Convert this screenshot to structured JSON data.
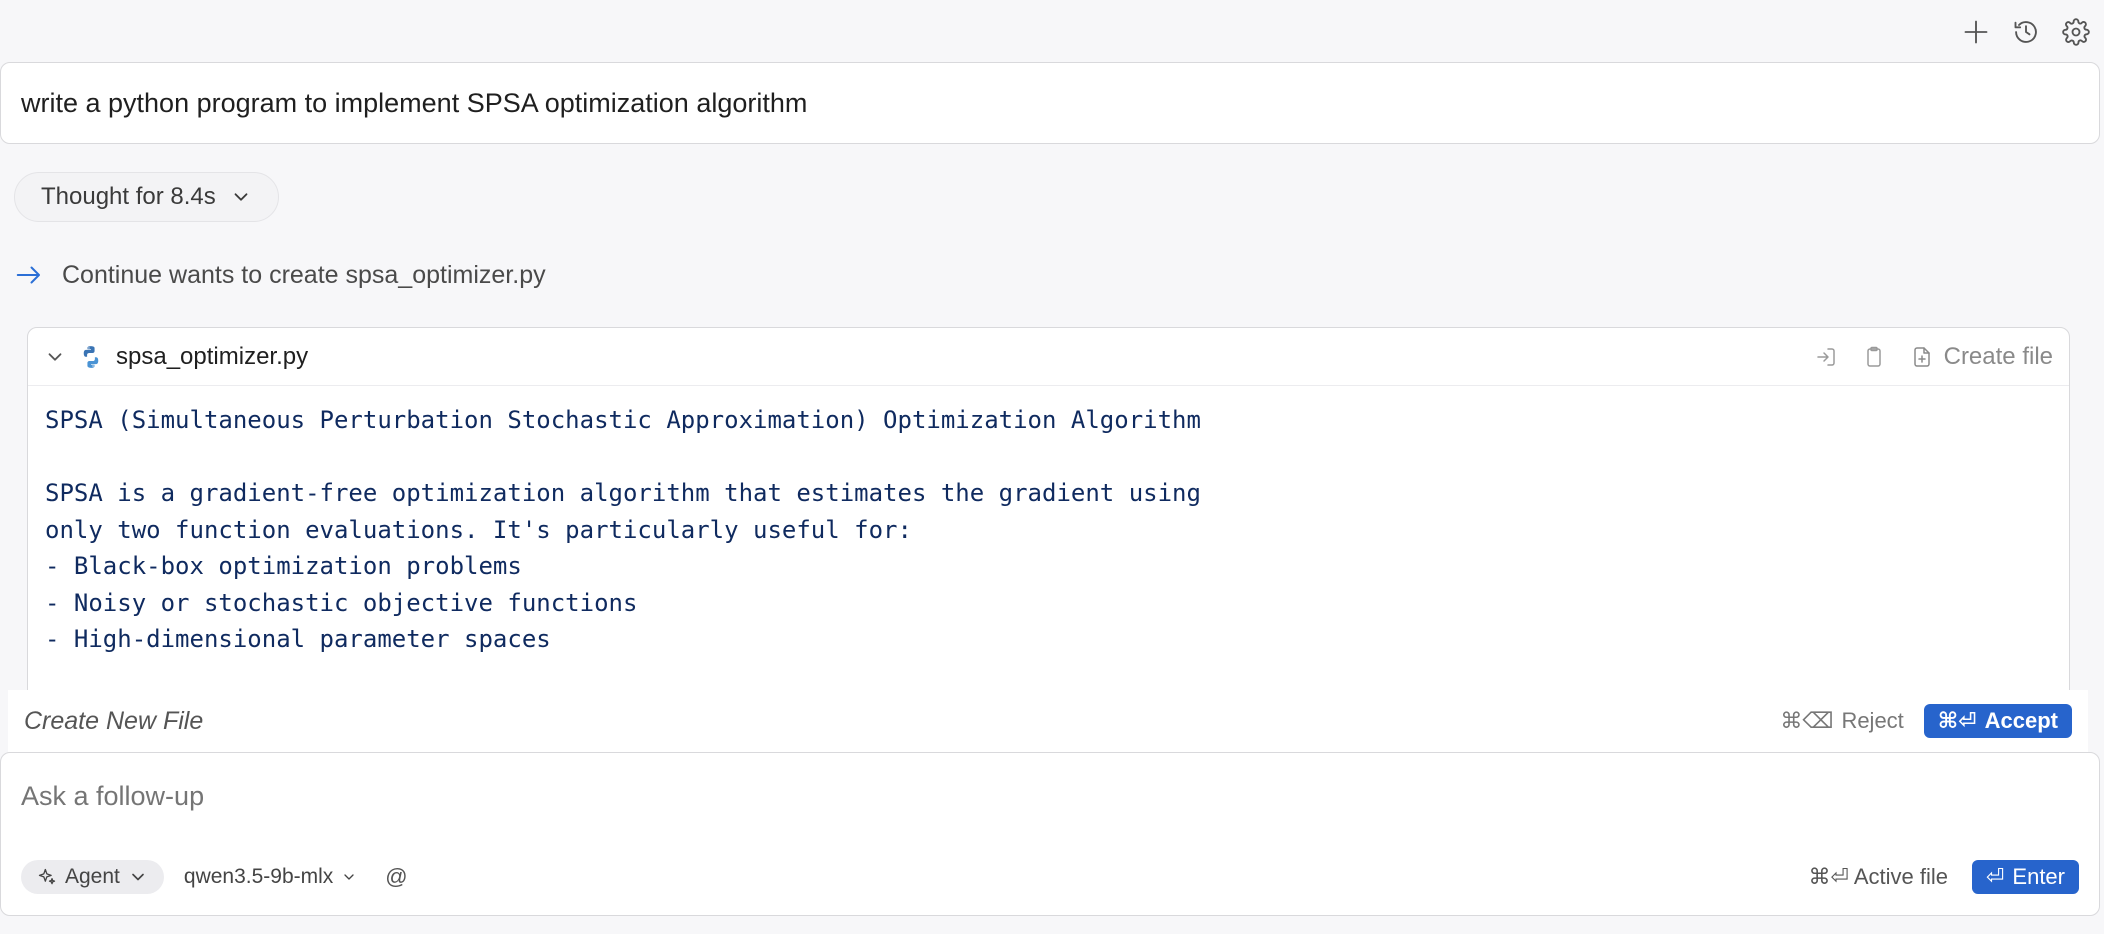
{
  "toolbar": {
    "icons": [
      "plus-icon",
      "history-icon",
      "gear-icon"
    ]
  },
  "prompt": {
    "text": "write a python program to implement SPSA optimization algorithm"
  },
  "thought": {
    "label": "Thought for 8.4s"
  },
  "continue": {
    "text": "Continue wants to create spsa_optimizer.py"
  },
  "file": {
    "name": "spsa_optimizer.py",
    "create_label": "Create file",
    "code_lines": [
      "SPSA (Simultaneous Perturbation Stochastic Approximation) Optimization Algorithm",
      "",
      "SPSA is a gradient-free optimization algorithm that estimates the gradient using",
      "only two function evaluations. It's particularly useful for:",
      "- Black-box optimization problems",
      "- Noisy or stochastic objective functions",
      "- High-dimensional parameter spaces"
    ]
  },
  "newfile": {
    "label": "Create New File",
    "reject_key": "⌘⌫",
    "reject_label": "Reject",
    "accept_key": "⌘⏎",
    "accept_label": "Accept"
  },
  "followup": {
    "placeholder": "Ask a follow-up",
    "agent_label": "Agent",
    "model_label": "qwen3.5-9b-mlx",
    "at_label": "@",
    "active_file_label": "⌘⏎ Active file",
    "enter_key": "⏎",
    "enter_label": "Enter"
  },
  "colors": {
    "accent": "#2764cc",
    "code_text": "#0f2a5f",
    "arrow": "#2b6fd6"
  }
}
